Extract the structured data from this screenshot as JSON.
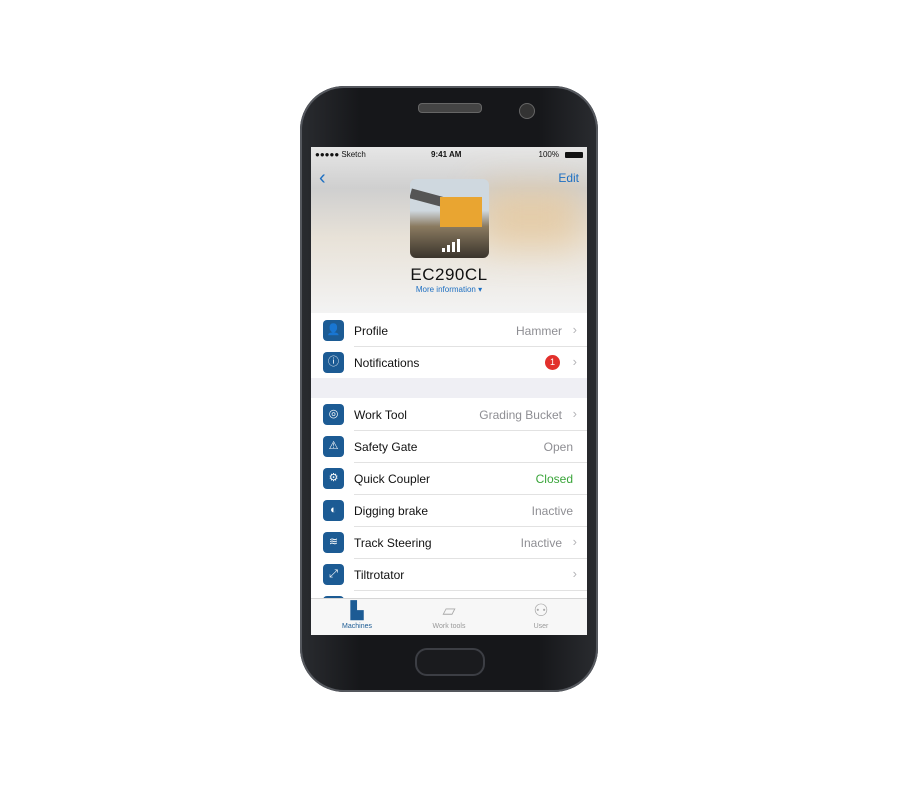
{
  "status": {
    "carrier": "●●●●● Sketch",
    "time": "9:41 AM",
    "battery": "100%"
  },
  "nav": {
    "back": "‹",
    "edit": "Edit"
  },
  "machine": {
    "name": "EC290CL",
    "more": "More information ▾"
  },
  "section1": [
    {
      "label": "Profile",
      "value": "Hammer",
      "icon": "user-icon",
      "glyph": "👤",
      "chevron": true
    },
    {
      "label": "Notifications",
      "badge": "1",
      "icon": "info-icon",
      "glyph": "ⓘ",
      "chevron": true
    }
  ],
  "section2": [
    {
      "label": "Work Tool",
      "value": "Grading Bucket",
      "icon": "work-tool-icon",
      "glyph": "◎",
      "chevron": true
    },
    {
      "label": "Safety Gate",
      "value": "Open",
      "icon": "warning-icon",
      "glyph": "⚠",
      "chevron": false
    },
    {
      "label": "Quick Coupler",
      "value": "Closed",
      "icon": "coupler-icon",
      "glyph": "⚙",
      "chevron": false,
      "color": "#3aa53a"
    },
    {
      "label": "Digging brake",
      "value": "Inactive",
      "icon": "brake-icon",
      "glyph": "◐",
      "chevron": false
    },
    {
      "label": "Track Steering",
      "value": "Inactive",
      "icon": "track-steering-icon",
      "glyph": "≋",
      "chevron": true
    },
    {
      "label": "Tiltrotator",
      "value": "",
      "icon": "tiltrotator-icon",
      "glyph": "⤢",
      "chevron": true
    }
  ],
  "tabs": [
    {
      "label": "Machines",
      "icon": "machines-icon",
      "glyph": "▙"
    },
    {
      "label": "Work tools",
      "icon": "work-tools-icon",
      "glyph": "▱"
    },
    {
      "label": "User",
      "icon": "user-icon",
      "glyph": "⚇"
    }
  ],
  "colors": {
    "accent": "#1c5b94",
    "link": "#1d6fc2",
    "badge": "#e2302c"
  }
}
